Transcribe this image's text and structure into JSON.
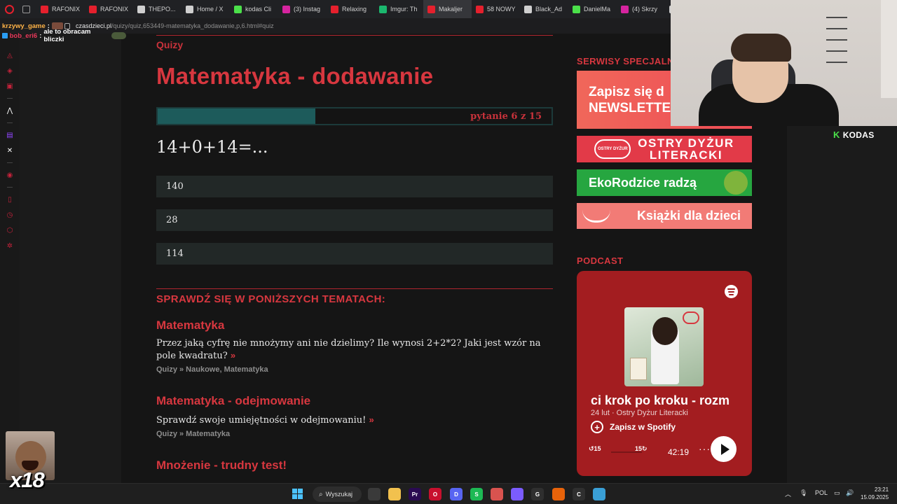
{
  "browser": {
    "tabs": [
      {
        "label": "RAFONIX",
        "color": "#e5202d"
      },
      {
        "label": "RAFONIX",
        "color": "#e5202d"
      },
      {
        "label": "THEPO...",
        "color": "#cfcfcf"
      },
      {
        "label": "Home / X",
        "color": "#cfcfcf"
      },
      {
        "label": "kodas Cli",
        "color": "#4be04a"
      },
      {
        "label": "(3) Instag",
        "color": "#d6249f"
      },
      {
        "label": "Relaxing",
        "color": "#e5202d"
      },
      {
        "label": "Imgur: Th",
        "color": "#1bb76e"
      },
      {
        "label": "Makaljer",
        "color": "#e5202d"
      },
      {
        "label": "58 NOWY",
        "color": "#e5202d"
      },
      {
        "label": "Black_Ad",
        "color": "#cfcfcf"
      },
      {
        "label": "DanielMa",
        "color": "#4be04a"
      },
      {
        "label": "(4) Skrzy",
        "color": "#d6249f"
      },
      {
        "label": "#",
        "color": "#cfcfcf"
      }
    ],
    "url_domain": "czasdzieci.pl",
    "url_path": "/quizy/quiz,653449-matematyka_dodawanie,p,6.html#quiz"
  },
  "chat": [
    {
      "user": "krzywy_game",
      "message": ""
    },
    {
      "user": "bob_eri6",
      "message": "ale to obracam bliczki"
    }
  ],
  "quiz": {
    "breadcrumb": "Quizy",
    "title": "Matematyka - dodawanie",
    "progress_current": 6,
    "progress_total": 15,
    "progress_label": "pytanie 6 z 15",
    "question": "14+0+14=...",
    "answers": [
      "140",
      "28",
      "114"
    ]
  },
  "related": {
    "heading": "SPRAWDŹ SIĘ W PONIŻSZYCH TEMATACH:",
    "items": [
      {
        "title": "Matematyka",
        "desc": "Przez jaką cyfrę nie mnożymy ani nie dzielimy? Ile wynosi 2+2*2? Jaki jest wzór na pole kwadratu?",
        "arrow": "»",
        "meta": "Quizy » Naukowe, Matematyka"
      },
      {
        "title": "Matematyka - odejmowanie",
        "desc": "Sprawdź swoje umiejętności w odejmowaniu!",
        "arrow": "»",
        "meta": "Quizy » Matematyka"
      },
      {
        "title": "Mnożenie - trudny test!",
        "desc": "",
        "arrow": "",
        "meta": ""
      }
    ]
  },
  "sidebar_right": {
    "special_heading": "SERWISY SPECJALNE",
    "banners": {
      "newsletter_line1": "Zapisz się d",
      "newsletter_line2": "NEWSLETTE",
      "ostry_badge": "OSTRY DYŻUR",
      "ostry_line1": "OSTRY DYŻUR",
      "ostry_line2": "LITERACKI",
      "eko": "EkoRodzice radzą",
      "ksiazki": "Książki dla dzieci"
    },
    "podcast_heading": "PODCAST"
  },
  "spotify": {
    "episode_title": "ci krok po kroku - rozm",
    "date": "24 lut",
    "show": "Ostry Dyżur Literacki",
    "meta": "24 lut · Ostry Dyżur Literacki",
    "save_label": "Zapisz w Spotify",
    "back_skip": "15",
    "forward_skip": "15",
    "duration": "42:19",
    "more": "···"
  },
  "stream": {
    "channel": "KODAS",
    "emote_counter": "x18"
  },
  "taskbar": {
    "search_label": "Wyszukaj",
    "language": "POL",
    "time": "23:21",
    "date": "15.09.2025",
    "apps": [
      {
        "name": "task-view",
        "label": "",
        "color": "#3a3a3a"
      },
      {
        "name": "explorer",
        "label": "",
        "color": "#f2c14e"
      },
      {
        "name": "premiere",
        "label": "Pr",
        "color": "#2a0a52"
      },
      {
        "name": "opera",
        "label": "O",
        "color": "#c8102e"
      },
      {
        "name": "discord",
        "label": "D",
        "color": "#5865f2"
      },
      {
        "name": "spotify",
        "label": "S",
        "color": "#1db954"
      },
      {
        "name": "chrome-alt",
        "label": "",
        "color": "#d9534f"
      },
      {
        "name": "app-purple",
        "label": "",
        "color": "#7b5cff"
      },
      {
        "name": "app-g",
        "label": "G",
        "color": "#2f2f2f"
      },
      {
        "name": "app-orange",
        "label": "",
        "color": "#e8630a"
      },
      {
        "name": "app-c",
        "label": "C",
        "color": "#2f2f2f"
      },
      {
        "name": "app-blue",
        "label": "",
        "color": "#3a9fd6"
      }
    ]
  },
  "colors": {
    "accent_red": "#d7373f",
    "progress_fill": "#1d5b5b",
    "answer_bg": "#222827",
    "spotify_card": "#a31d20"
  }
}
